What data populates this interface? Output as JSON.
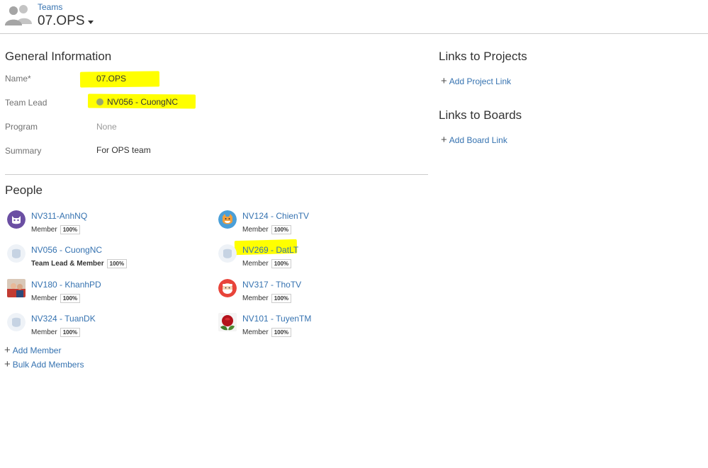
{
  "header": {
    "breadcrumb": "Teams",
    "title": "07.OPS"
  },
  "general": {
    "title": "General Information",
    "fields": [
      {
        "label": "Name*",
        "value": "07.OPS"
      },
      {
        "label": "Team Lead",
        "value": "NV056 - CuongNC"
      },
      {
        "label": "Program",
        "value": "None"
      },
      {
        "label": "Summary",
        "value": "For OPS team"
      }
    ]
  },
  "people": {
    "title": "People",
    "members": [
      {
        "name": "NV311-AnhNQ",
        "role": "Member",
        "allocation": "100%",
        "avatar": "purple-cat-avatar-icon"
      },
      {
        "name": "NV124 - ChienTV",
        "role": "Member",
        "allocation": "100%",
        "avatar": "fox-avatar-icon"
      },
      {
        "name": "NV056 - CuongNC",
        "role": "Team Lead & Member",
        "allocation": "100%",
        "avatar": "default-avatar-icon"
      },
      {
        "name": "NV269 - DatLT",
        "role": "Member",
        "allocation": "100%",
        "avatar": "default-avatar-icon"
      },
      {
        "name": "NV180 - KhanhPD",
        "role": "Member",
        "allocation": "100%",
        "avatar": "photo-avatar-icon"
      },
      {
        "name": "NV317 - ThoTV",
        "role": "Member",
        "allocation": "100%",
        "avatar": "santa-avatar-icon"
      },
      {
        "name": "NV324 - TuanDK",
        "role": "Member",
        "allocation": "100%",
        "avatar": "default-avatar-icon"
      },
      {
        "name": "NV101 - TuyenTM",
        "role": "Member",
        "allocation": "100%",
        "avatar": "rose-photo-avatar-icon"
      }
    ],
    "add_member": "Add Member",
    "bulk_add": "Bulk Add Members"
  },
  "projects": {
    "title": "Links to Projects",
    "add_link": "Add Project Link"
  },
  "boards": {
    "title": "Links to Boards",
    "add_link": "Add Board Link"
  },
  "colors": {
    "link": "#3572b0",
    "highlight": "#ffff00",
    "divider": "#cccccc"
  }
}
